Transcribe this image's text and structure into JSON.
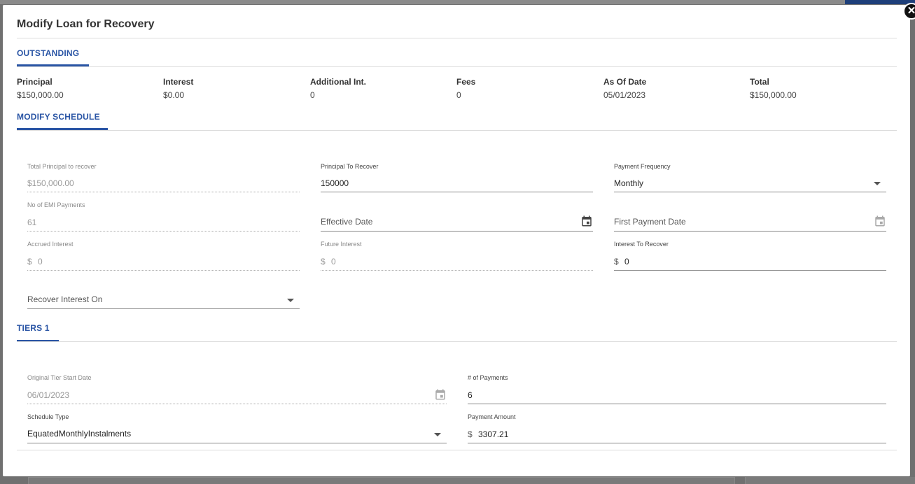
{
  "modal": {
    "title": "Modify Loan for Recovery",
    "close_glyph": "✕"
  },
  "tabs": {
    "outstanding": "OUTSTANDING",
    "modify": "MODIFY SCHEDULE",
    "tiers": "TIERS 1"
  },
  "outstanding": [
    {
      "label": "Principal",
      "value": "$150,000.00"
    },
    {
      "label": "Interest",
      "value": "$0.00"
    },
    {
      "label": "Additional Int.",
      "value": "0"
    },
    {
      "label": "Fees",
      "value": "0"
    },
    {
      "label": "As Of Date",
      "value": "05/01/2023"
    },
    {
      "label": "Total",
      "value": "$150,000.00"
    }
  ],
  "schedule": {
    "total_principal": {
      "label": "Total Principal to recover",
      "value": "$150,000.00"
    },
    "principal_to_recover": {
      "label": "Principal To Recover",
      "value": "150000"
    },
    "payment_frequency": {
      "label": "Payment Frequency",
      "value": "Monthly"
    },
    "emi_payments": {
      "label": "No of EMI Payments",
      "value": "61"
    },
    "effective_date": {
      "placeholder": "Effective Date"
    },
    "first_payment_date": {
      "placeholder": "First Payment Date"
    },
    "accrued_interest": {
      "label": "Accrued Interest",
      "prefix": "$",
      "value": "0"
    },
    "future_interest": {
      "label": "Future Interest",
      "prefix": "$",
      "value": "0"
    },
    "interest_to_recover": {
      "label": "Interest To Recover",
      "prefix": "$",
      "value": "0"
    },
    "recover_interest_on": {
      "placeholder": "Recover Interest On"
    }
  },
  "tiers": {
    "original_start": {
      "label": "Original Tier Start Date",
      "value": "06/01/2023"
    },
    "num_payments": {
      "label": "# of Payments",
      "value": "6"
    },
    "schedule_type": {
      "label": "Schedule Type",
      "value": "EquatedMonthlyInstalments"
    },
    "payment_amount": {
      "label": "Payment Amount",
      "prefix": "$",
      "value": "3307.21"
    }
  },
  "colors": {
    "accent": "#2a55a5",
    "icon_active": "#444444",
    "icon_disabled": "#aaaaaa"
  }
}
